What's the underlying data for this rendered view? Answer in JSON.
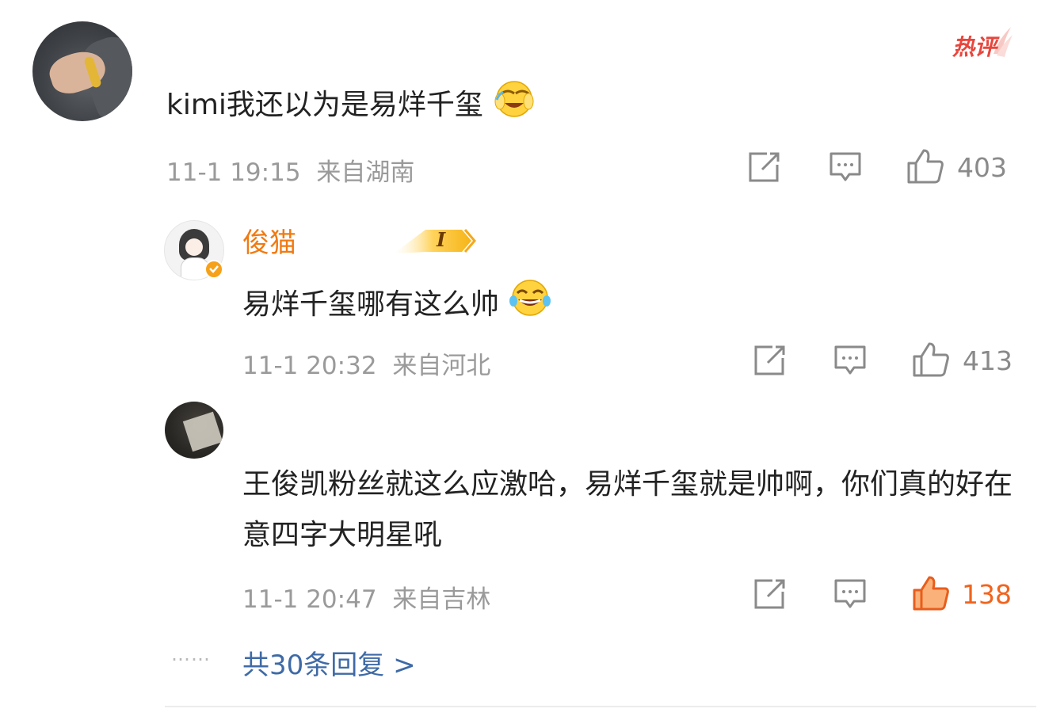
{
  "badge": {
    "hot_label": "热评"
  },
  "comment": {
    "text": "kimi我还以为是易烊千玺",
    "emoji": "laugh-covering-face",
    "time": "11-1 19:15",
    "location": "来自湖南",
    "like_count": "403"
  },
  "replies": [
    {
      "username": "俊猫",
      "level": "I",
      "verified": true,
      "text": "易烊千玺哪有这么帅",
      "emoji": "tears-of-joy",
      "time": "11-1 20:32",
      "location": "来自河北",
      "like_count": "413"
    },
    {
      "text": "王俊凯粉丝就这么应激哈，易烊千玺就是帅啊，你们真的好在意四字大明星吼",
      "time": "11-1 20:47",
      "location": "来自吉林",
      "like_count": "138",
      "liked": true
    }
  ],
  "more_replies": {
    "dots": "……",
    "label": "共30条回复 >"
  },
  "colors": {
    "username": "#f07a12",
    "link": "#3f6aa6",
    "liked": "#f0641e",
    "meta": "#9a9a9a",
    "hot": "#e8453c"
  }
}
